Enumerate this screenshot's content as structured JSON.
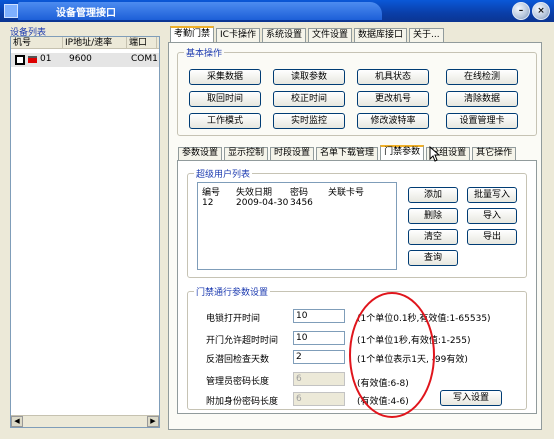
{
  "window": {
    "title": "设备管理接口"
  },
  "sidebar": {
    "label": "设备列表",
    "columns": [
      "机号",
      "IP地址/速率",
      "端口"
    ],
    "rows": [
      {
        "id": "01",
        "addr": "9600",
        "port": "COM1"
      }
    ]
  },
  "main_tabs": [
    "考勤门禁",
    "IC卡操作",
    "系统设置",
    "文件设置",
    "数据库接口",
    "关于..."
  ],
  "basic_ops": {
    "legend": "基本操作",
    "buttons": [
      "采集数据",
      "读取参数",
      "机具状态",
      "在线检测",
      "取回时间",
      "校正时间",
      "更改机号",
      "清除数据",
      "工作模式",
      "实时监控",
      "修改波特率",
      "设置管理卡"
    ]
  },
  "sub_tabs": [
    "参数设置",
    "显示控制",
    "时段设置",
    "名单下载管理",
    "门禁参数",
    "分组设置",
    "其它操作"
  ],
  "super_users": {
    "legend": "超级用户列表",
    "columns": [
      "编号",
      "失效日期",
      "密码",
      "关联卡号"
    ],
    "rows": [
      {
        "no": "12",
        "date": "2009-04-30",
        "pwd": "3456",
        "card": ""
      }
    ],
    "buttons": [
      "添加",
      "批量写入",
      "删除",
      "导入",
      "清空",
      "导出",
      "查询"
    ]
  },
  "access_params": {
    "legend": "门禁通行参数设置",
    "rows": [
      {
        "label": "电锁打开时间",
        "value": "10",
        "hint": "(1个单位0.1秒,有效值:1-65535)",
        "disabled": false
      },
      {
        "label": "开门允许超时时间",
        "value": "10",
        "hint": "(1个单位1秒,有效值:1-255)",
        "disabled": false
      },
      {
        "label": "反潜回检查天数",
        "value": "2",
        "hint": "(1个单位表示1天, -99有效)",
        "disabled": false
      },
      {
        "label": "管理员密码长度",
        "value": "6",
        "hint": "(有效值:6-8)",
        "disabled": true
      },
      {
        "label": "附加身份密码长度",
        "value": "6",
        "hint": "(有效值:4-6)",
        "disabled": true
      }
    ],
    "write_button": "写入设置"
  },
  "colors": {
    "titlebar": "#0a3ea8",
    "highlight": "#e0151c",
    "legend": "#1d3bb0"
  }
}
